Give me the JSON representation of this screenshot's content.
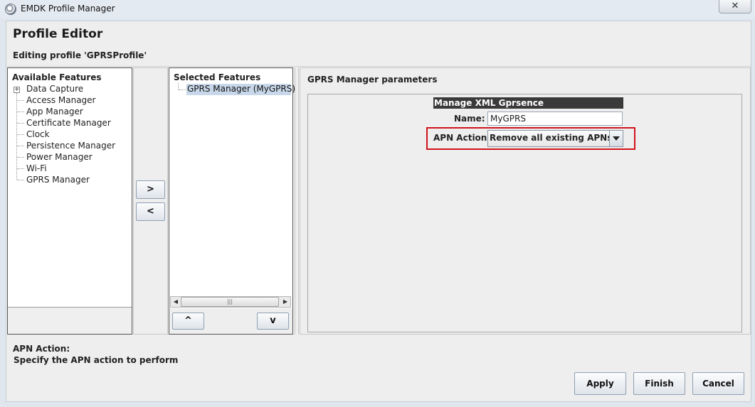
{
  "window": {
    "title": "EMDK Profile Manager",
    "close_glyph": "✕"
  },
  "header": {
    "title": "Profile Editor",
    "subtitle": "Editing profile 'GPRSProfile'"
  },
  "available": {
    "heading": "Available Features",
    "expand_glyph": "+",
    "items": [
      {
        "label": "Data Capture",
        "expandable": true
      },
      {
        "label": "Access Manager"
      },
      {
        "label": "App Manager"
      },
      {
        "label": "Certificate Manager"
      },
      {
        "label": "Clock"
      },
      {
        "label": "Persistence Manager"
      },
      {
        "label": "Power Manager"
      },
      {
        "label": "Wi-Fi"
      },
      {
        "label": "GPRS Manager"
      }
    ]
  },
  "transfer": {
    "add_label": ">",
    "remove_label": "<"
  },
  "selected": {
    "heading": "Selected Features",
    "items": [
      {
        "label": "GPRS Manager (MyGPRS)",
        "selected": true
      }
    ],
    "scroll_left": "◀",
    "scroll_right": "▶",
    "scroll_grip": "|||",
    "move_up_label": "^",
    "move_down_label": "v"
  },
  "params": {
    "title": "GPRS Manager parameters",
    "section_header": "Manage XML Gprsence",
    "name_label": "Name:",
    "name_value": "MyGPRS",
    "apn_label": "APN Action:",
    "apn_value": "Remove all existing APNs",
    "highlight_color": "#d0141c"
  },
  "help": {
    "title": "APN Action:",
    "description": "Specify the APN action to perform"
  },
  "footer": {
    "apply_label": "Apply",
    "finish_label": "Finish",
    "cancel_label": "Cancel"
  },
  "icons": [
    "app-icon",
    "close-icon",
    "expand-icon",
    "chevron-down-icon",
    "scroll-left-icon",
    "scroll-right-icon"
  ]
}
